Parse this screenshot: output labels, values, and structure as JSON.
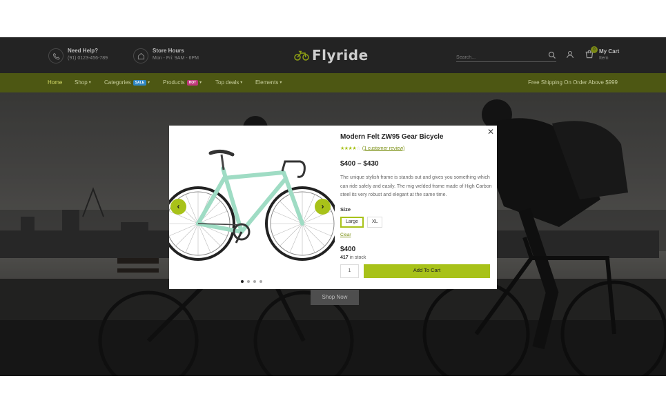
{
  "header": {
    "help_title": "Need Help?",
    "help_phone": "(91) 0123-456-789",
    "hours_title": "Store Hours",
    "hours_text": "Mon - Fri: 9AM - 6PM",
    "logo": "Flyride",
    "search_placeholder": "Search...",
    "cart_count": "0",
    "cart_title": "My Cart",
    "cart_sub": "Item"
  },
  "nav": {
    "items": [
      {
        "label": "Home"
      },
      {
        "label": "Shop"
      },
      {
        "label": "Categories",
        "tag": "SALE",
        "tag_color": "#2e86c1"
      },
      {
        "label": "Products",
        "tag": "HOT",
        "tag_color": "#c0397a"
      },
      {
        "label": "Top deals"
      },
      {
        "label": "Elements"
      }
    ],
    "shipping": "Free Shipping On Order Above $999"
  },
  "hero": {
    "cta": "Shop Now"
  },
  "modal": {
    "title": "Modern Felt ZW95 Gear Bicycle",
    "rating": 4,
    "review_link": "(1 customer review)",
    "price_range": "$400 – $430",
    "description": "The unique stylish frame is stands out and gives you something which can ride safely and easily. The mig welded frame made of High Carbon steel its very robust and elegant at the same time.",
    "size_label": "Size",
    "sizes": [
      "Large",
      "XL"
    ],
    "selected_size": "Large",
    "clear": "Clear",
    "variant_price": "$400",
    "stock_count": "417",
    "stock_text": "in stock",
    "quantity": "1",
    "add_to_cart": "Add To Cart",
    "gallery_dots": 4,
    "gallery_active": 1
  },
  "colors": {
    "accent": "#a8c219",
    "nav_bg": "#4d5713",
    "header_bg": "#232323"
  }
}
